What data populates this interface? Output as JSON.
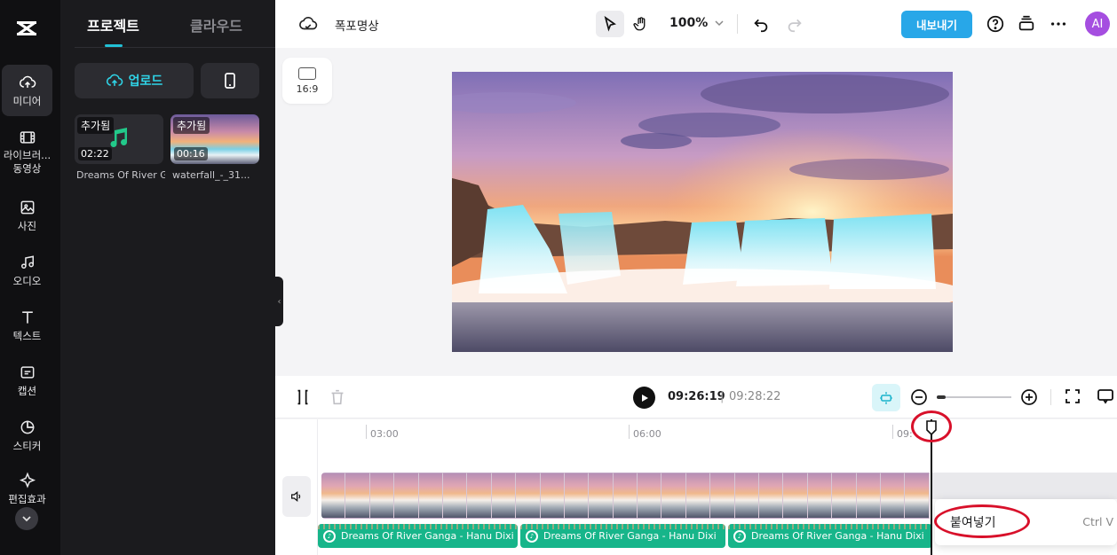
{
  "app": {
    "project_name": "폭포명상"
  },
  "rail": {
    "items": [
      {
        "label": "미디어",
        "icon": "cloud-upload-icon",
        "active": true
      },
      {
        "label": "라이브러...",
        "label2": "동영상",
        "icon": "film-icon"
      },
      {
        "label": "사진",
        "icon": "image-icon"
      },
      {
        "label": "오디오",
        "icon": "music-note-icon"
      },
      {
        "label": "텍스트",
        "icon": "text-icon"
      },
      {
        "label": "캡션",
        "icon": "caption-icon"
      },
      {
        "label": "스티커",
        "icon": "sticker-icon"
      },
      {
        "label": "편집효과",
        "icon": "sparkle-icon"
      }
    ]
  },
  "panel": {
    "tabs": [
      "프로젝트",
      "클라우드"
    ],
    "upload_label": "업로드",
    "media": [
      {
        "badge": "추가됨",
        "duration": "02:22",
        "name": "Dreams Of River Ganga",
        "type": "audio"
      },
      {
        "badge": "추가됨",
        "duration": "00:16",
        "name": "waterfall_-_31...",
        "type": "video"
      }
    ]
  },
  "topbar": {
    "zoom": "100%",
    "export_label": "내보내기",
    "avatar_initials": "AI"
  },
  "canvas": {
    "ratio_label": "16:9"
  },
  "timeline": {
    "current_time": "09:26:19",
    "separator": "|",
    "total_time": "09:28:22",
    "ruler": [
      "03:00",
      "06:00",
      "09:"
    ],
    "audio_clips": [
      "Dreams Of River Ganga - Hanu Dixi",
      "Dreams Of River Ganga - Hanu Dixi",
      "Dreams Of River Ganga - Hanu Dixi"
    ]
  },
  "context_menu": {
    "item": "붙여넣기",
    "shortcut": "Ctrl V"
  },
  "colors": {
    "accent": "#22c1d6",
    "export": "#28a7e8",
    "highlight": "#d8102a",
    "audio": "#17b58a"
  }
}
